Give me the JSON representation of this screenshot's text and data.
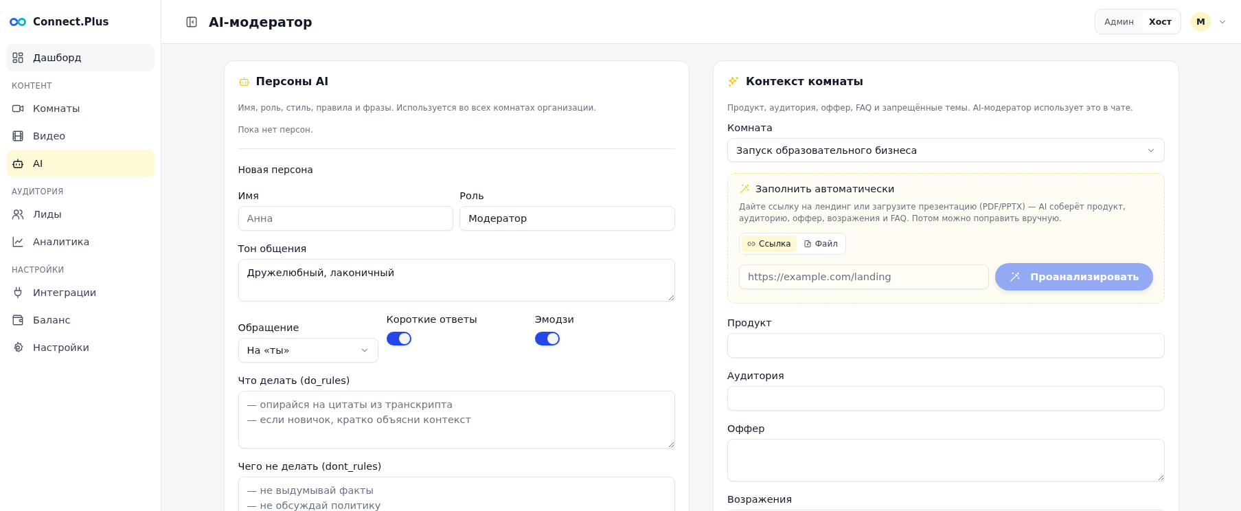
{
  "sidebar": {
    "brand": "Connect.Plus",
    "items": [
      {
        "kind": "link",
        "label": "Дашборд",
        "selected": false,
        "hovered": true
      },
      {
        "kind": "heading",
        "label": "КОНТЕНТ"
      },
      {
        "kind": "link",
        "label": "Комнаты",
        "selected": false
      },
      {
        "kind": "link",
        "label": "Видео",
        "selected": false
      },
      {
        "kind": "link",
        "label": "AI",
        "selected": true
      },
      {
        "kind": "heading",
        "label": "АУДИТОРИЯ"
      },
      {
        "kind": "link",
        "label": "Лиды",
        "selected": false
      },
      {
        "kind": "link",
        "label": "Аналитика",
        "selected": false
      },
      {
        "kind": "heading",
        "label": "НАСТРОЙКИ"
      },
      {
        "kind": "link",
        "label": "Интеграции",
        "selected": false
      },
      {
        "kind": "link",
        "label": "Баланс",
        "selected": false
      },
      {
        "kind": "link",
        "label": "Настройки",
        "selected": false
      }
    ]
  },
  "header": {
    "title": "AI-модератор",
    "roles": [
      {
        "label": "Админ",
        "selected": false
      },
      {
        "label": "Хост",
        "selected": true
      }
    ],
    "avatar": "M"
  },
  "personas": {
    "title": "Персоны AI",
    "description": "Имя, роль, стиль, правила и фразы. Используется во всех комнатах организации.",
    "empty_note": "Пока нет персон.",
    "form_title": "Новая персона",
    "name": {
      "label": "Имя",
      "placeholder": "Анна"
    },
    "role": {
      "label": "Роль",
      "value": "Модератор"
    },
    "tone": {
      "label": "Тон общения",
      "value": "Дружелюбный, лаконичный"
    },
    "address": {
      "label": "Обращение",
      "value": "На «ты»"
    },
    "toggles": [
      {
        "label": "Короткие ответы",
        "on": true
      },
      {
        "label": "Эмодзи",
        "on": true
      }
    ],
    "do_rules": {
      "label": "Что делать (do_rules)",
      "placeholder": "— опирайся на цитаты из транскрипта\n— если новичок, кратко объясни контекст"
    },
    "dont_rules": {
      "label": "Чего не делать (dont_rules)",
      "placeholder": "— не выдумывай факты\n— не обсуждай политику"
    }
  },
  "context": {
    "title": "Контекст комнаты",
    "description": "Продукт, аудитория, оффер, FAQ и запрещённые темы. AI-модератор использует это в чате.",
    "room": {
      "label": "Комната",
      "value": "Запуск образовательного бизнеса"
    },
    "autofill": {
      "title": "Заполнить автоматически",
      "description": "Дайте ссылку на лендинг или загрузите презентацию (PDF/PPTX) — AI соберёт продукт, аудиторию, оффер, возражения и FAQ. Потом можно поправить вручную.",
      "modes": [
        {
          "label": "Ссылка",
          "selected": true
        },
        {
          "label": "Файл",
          "selected": false
        }
      ],
      "url": {
        "placeholder": "https://example.com/landing"
      },
      "analyze_button": {
        "label": "Проанализировать",
        "disabled": true
      }
    },
    "fields": [
      {
        "kind": "input",
        "label": "Продукт"
      },
      {
        "kind": "input",
        "label": "Аудитория"
      },
      {
        "kind": "textarea",
        "label": "Оффер"
      },
      {
        "kind": "input",
        "label": "Возражения"
      }
    ]
  }
}
